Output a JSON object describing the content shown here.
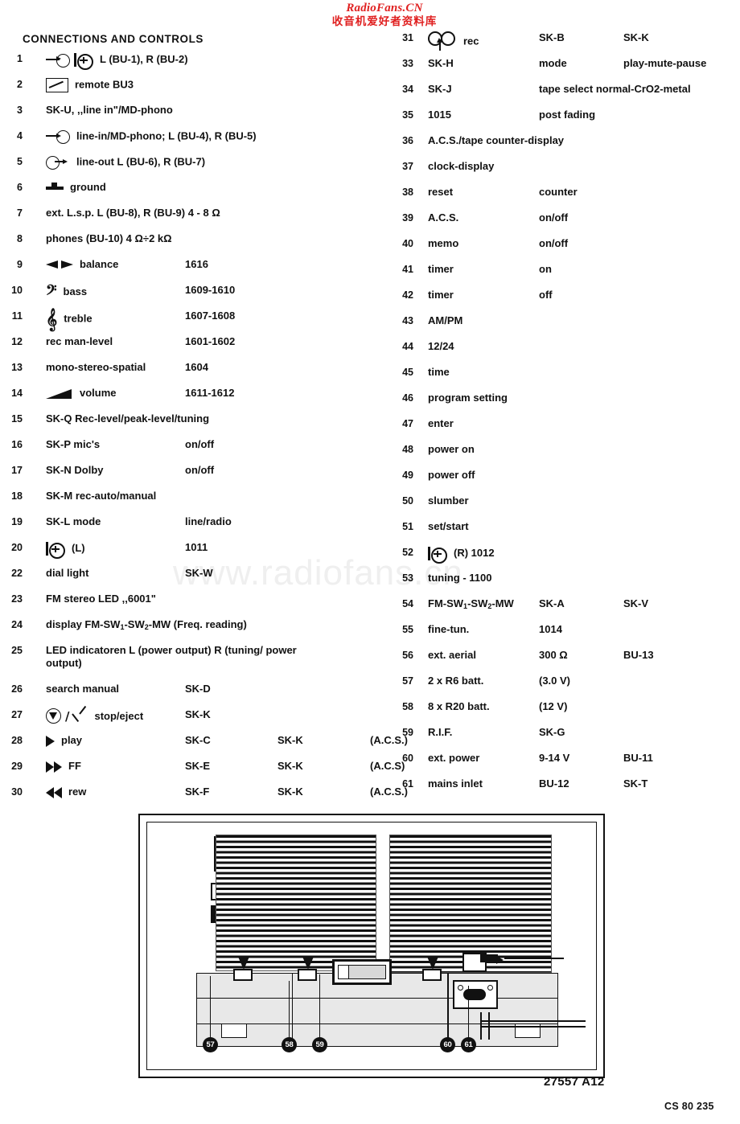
{
  "watermark": {
    "latin": "RadioFans.CN",
    "cjk": "收音机爱好者资料库",
    "ghost": "www.radiofans.cn"
  },
  "title": "CONNECTIONS AND CONTROLS",
  "codes": {
    "drawing": "27557 A12",
    "sheet": "CS 80 235"
  },
  "left_column": [
    {
      "num": "1",
      "icon": "line-in-plus-mic",
      "c1": "L (BU-1), R (BU-2)",
      "c2": "",
      "c3": ""
    },
    {
      "num": "2",
      "icon": "remote",
      "c1": "remote BU3",
      "c2": "",
      "c3": ""
    },
    {
      "num": "3",
      "icon": "",
      "c1": "SK-U, ,,line in\"/MD-phono",
      "c2": "",
      "c3": ""
    },
    {
      "num": "4",
      "icon": "line-in",
      "c1": "line-in/MD-phono; L (BU-4), R (BU-5)",
      "c2": "",
      "c3": ""
    },
    {
      "num": "5",
      "icon": "line-out",
      "c1": "line-out L (BU-6), R (BU-7)",
      "c2": "",
      "c3": ""
    },
    {
      "num": "6",
      "icon": "ground",
      "c1": "ground",
      "c2": "",
      "c3": ""
    },
    {
      "num": "7",
      "icon": "",
      "c1": "ext. L.s.p. L (BU-8), R (BU-9) 4 - 8 Ω",
      "c2": "",
      "c3": ""
    },
    {
      "num": "8",
      "icon": "",
      "c1": "phones (BU-10) 4 Ω÷2 kΩ",
      "c2": "",
      "c3": ""
    },
    {
      "num": "9",
      "icon": "balance",
      "c1": "balance",
      "c2": "1616",
      "c3": ""
    },
    {
      "num": "10",
      "icon": "bass-clef",
      "c1": "bass",
      "c2": "1609-1610",
      "c3": ""
    },
    {
      "num": "11",
      "icon": "treble-clef",
      "c1": "treble",
      "c2": "1607-1608",
      "c3": ""
    },
    {
      "num": "12",
      "icon": "",
      "c1": "rec man-level",
      "c2": "1601-1602",
      "c3": ""
    },
    {
      "num": "13",
      "icon": "",
      "c1": "mono-stereo-spatial",
      "c2": "1604",
      "c3": ""
    },
    {
      "num": "14",
      "icon": "volume",
      "c1": "volume",
      "c2": "1611-1612",
      "c3": ""
    },
    {
      "num": "15",
      "icon": "",
      "c1": "SK-Q   Rec-level/peak-level/tuning",
      "c2": "",
      "c3": ""
    },
    {
      "num": "16",
      "icon": "",
      "c1": "SK-P   mic's",
      "c2": "on/off",
      "c3": ""
    },
    {
      "num": "17",
      "icon": "",
      "c1": "SK-N   Dolby",
      "c2": "on/off",
      "c3": ""
    },
    {
      "num": "18",
      "icon": "",
      "c1": "SK-M   rec-auto/manual",
      "c2": "",
      "c3": ""
    },
    {
      "num": "19",
      "icon": "",
      "c1": "SK-L   mode",
      "c2": "line/radio",
      "c3": ""
    },
    {
      "num": "20",
      "icon": "mic",
      "c1": "(L)",
      "c2": "1011",
      "c3": ""
    },
    {
      "num": "22",
      "icon": "",
      "c1": "dial light",
      "c2": "SK-W",
      "c3": ""
    },
    {
      "num": "23",
      "icon": "",
      "c1": "FM stereo LED ,,6001\"",
      "c2": "",
      "c3": ""
    },
    {
      "num": "24",
      "icon": "",
      "c1": "display FM-SW1-SW2-MW (Freq. reading)",
      "c2": "",
      "c3": ""
    },
    {
      "num": "25",
      "icon": "",
      "c1": "LED indicatoren L (power output) R (tuning/ power output)",
      "c2": "",
      "c3": ""
    },
    {
      "num": "26",
      "icon": "",
      "c1": "search manual",
      "c2": "SK-D",
      "c3": ""
    },
    {
      "num": "27",
      "icon": "stop-eject",
      "c1": "stop/eject",
      "c2": "SK-K",
      "c3": ""
    },
    {
      "num": "28",
      "icon": "play",
      "c1": "play",
      "c2": "SK-C",
      "c3": "SK-K",
      "c4": "(A.C.S.)"
    },
    {
      "num": "29",
      "icon": "ff",
      "c1": "FF",
      "c2": "SK-E",
      "c3": "SK-K",
      "c4": "(A.C.S)"
    },
    {
      "num": "30",
      "icon": "rew",
      "c1": "rew",
      "c2": "SK-F",
      "c3": "SK-K",
      "c4": "(A.C.S.)"
    }
  ],
  "right_column": [
    {
      "num": "31",
      "icon": "rec",
      "c1": "rec",
      "c2": "SK-B",
      "c3": "SK-K"
    },
    {
      "num": "33",
      "icon": "",
      "c1": "SK-H",
      "c2": "mode",
      "c3": "play-mute-pause"
    },
    {
      "num": "34",
      "icon": "",
      "c1": "SK-J",
      "c2": "tape select normal-CrO2-metal",
      "c3": ""
    },
    {
      "num": "35",
      "icon": "",
      "c1": "1015",
      "c2": "post fading",
      "c3": ""
    },
    {
      "num": "36",
      "icon": "",
      "c1": "A.C.S./tape counter-display",
      "c2": "",
      "c3": ""
    },
    {
      "num": "37",
      "icon": "",
      "c1": "clock-display",
      "c2": "",
      "c3": ""
    },
    {
      "num": "38",
      "icon": "",
      "c1": "reset",
      "c2": "counter",
      "c3": ""
    },
    {
      "num": "39",
      "icon": "",
      "c1": "A.C.S.",
      "c2": "on/off",
      "c3": ""
    },
    {
      "num": "40",
      "icon": "",
      "c1": "memo",
      "c2": "on/off",
      "c3": ""
    },
    {
      "num": "41",
      "icon": "",
      "c1": "timer",
      "c2": "on",
      "c3": ""
    },
    {
      "num": "42",
      "icon": "",
      "c1": "timer",
      "c2": "off",
      "c3": ""
    },
    {
      "num": "43",
      "icon": "",
      "c1": "AM/PM",
      "c2": "",
      "c3": ""
    },
    {
      "num": "44",
      "icon": "",
      "c1": "12/24",
      "c2": "",
      "c3": ""
    },
    {
      "num": "45",
      "icon": "",
      "c1": "time",
      "c2": "",
      "c3": ""
    },
    {
      "num": "46",
      "icon": "",
      "c1": "program setting",
      "c2": "",
      "c3": ""
    },
    {
      "num": "47",
      "icon": "",
      "c1": "enter",
      "c2": "",
      "c3": ""
    },
    {
      "num": "48",
      "icon": "",
      "c1": "power on",
      "c2": "",
      "c3": ""
    },
    {
      "num": "49",
      "icon": "",
      "c1": "power off",
      "c2": "",
      "c3": ""
    },
    {
      "num": "50",
      "icon": "",
      "c1": "slumber",
      "c2": "",
      "c3": ""
    },
    {
      "num": "51",
      "icon": "",
      "c1": "set/start",
      "c2": "",
      "c3": ""
    },
    {
      "num": "52",
      "icon": "mic",
      "c1": "(R) 1012",
      "c2": "",
      "c3": ""
    },
    {
      "num": "53",
      "icon": "",
      "c1": "tuning - 1100",
      "c2": "",
      "c3": ""
    },
    {
      "num": "54",
      "icon": "",
      "c1": "FM-SW1-SW2-MW",
      "c2": "SK-A",
      "c3": "SK-V"
    },
    {
      "num": "55",
      "icon": "",
      "c1": "fine-tun.",
      "c2": "1014",
      "c3": ""
    },
    {
      "num": "56",
      "icon": "",
      "c1": "ext. aerial",
      "c2": "300 Ω",
      "c3": "BU-13"
    },
    {
      "num": "57",
      "icon": "",
      "c1": "2 x R6 batt.",
      "c2": "(3.0 V)",
      "c3": ""
    },
    {
      "num": "58",
      "icon": "",
      "c1": "8 x R20 batt.",
      "c2": "(12 V)",
      "c3": ""
    },
    {
      "num": "59",
      "icon": "",
      "c1": "R.I.F.",
      "c2": "SK-G",
      "c3": ""
    },
    {
      "num": "60",
      "icon": "",
      "c1": "ext. power",
      "c2": "9-14 V",
      "c3": "BU-11"
    },
    {
      "num": "61",
      "icon": "",
      "c1": "mains inlet",
      "c2": "BU-12",
      "c3": "SK-T"
    }
  ],
  "diagram": {
    "callouts": [
      "57",
      "58",
      "59",
      "60",
      "61"
    ]
  }
}
